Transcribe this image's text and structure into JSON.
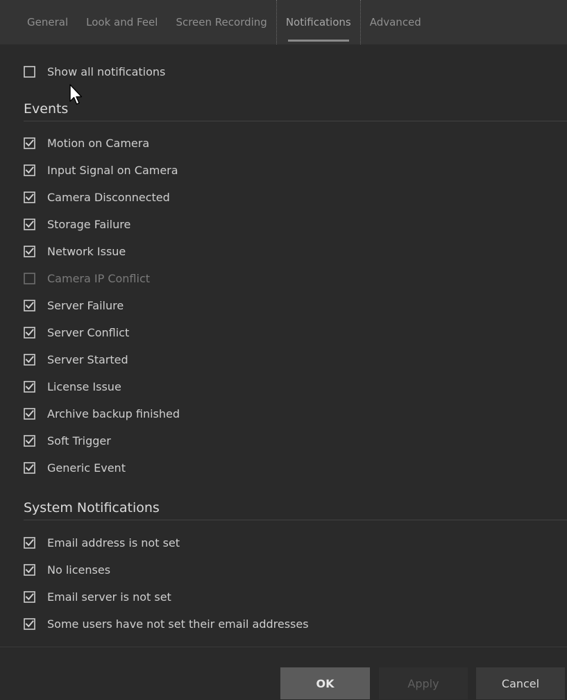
{
  "tabs": [
    {
      "label": "General",
      "active": false
    },
    {
      "label": "Look and Feel",
      "active": false
    },
    {
      "label": "Screen Recording",
      "active": false
    },
    {
      "label": "Notifications",
      "active": true
    },
    {
      "label": "Advanced",
      "active": false
    }
  ],
  "show_all": {
    "label": "Show all notifications",
    "checked": false
  },
  "events": {
    "title": "Events",
    "items": [
      {
        "label": "Motion on Camera",
        "checked": true,
        "disabled": false
      },
      {
        "label": "Input Signal on Camera",
        "checked": true,
        "disabled": false
      },
      {
        "label": "Camera Disconnected",
        "checked": true,
        "disabled": false
      },
      {
        "label": "Storage Failure",
        "checked": true,
        "disabled": false
      },
      {
        "label": "Network Issue",
        "checked": true,
        "disabled": false
      },
      {
        "label": "Camera IP Conflict",
        "checked": false,
        "disabled": true
      },
      {
        "label": "Server Failure",
        "checked": true,
        "disabled": false
      },
      {
        "label": "Server Conflict",
        "checked": true,
        "disabled": false
      },
      {
        "label": "Server Started",
        "checked": true,
        "disabled": false
      },
      {
        "label": "License Issue",
        "checked": true,
        "disabled": false
      },
      {
        "label": "Archive backup finished",
        "checked": true,
        "disabled": false
      },
      {
        "label": "Soft Trigger",
        "checked": true,
        "disabled": false
      },
      {
        "label": "Generic Event",
        "checked": true,
        "disabled": false
      }
    ]
  },
  "system": {
    "title": "System Notifications",
    "items": [
      {
        "label": "Email address is not set",
        "checked": true,
        "disabled": false
      },
      {
        "label": "No licenses",
        "checked": true,
        "disabled": false
      },
      {
        "label": "Email server is not set",
        "checked": true,
        "disabled": false
      },
      {
        "label": "Some users have not set their email addresses",
        "checked": true,
        "disabled": false
      }
    ]
  },
  "footer": {
    "ok_label": "OK",
    "apply_label": "Apply",
    "cancel_label": "Cancel"
  },
  "colors": {
    "background": "#2a2a2a",
    "tabbar": "#343434",
    "text": "#cfcfcf",
    "disabled_text": "#7a7a7a",
    "ok_button": "#5b5b5b"
  },
  "icons": {
    "checkbox_checked": "checkbox-checked-icon",
    "checkbox_unchecked": "checkbox-unchecked-icon",
    "cursor": "mouse-pointer-icon"
  }
}
